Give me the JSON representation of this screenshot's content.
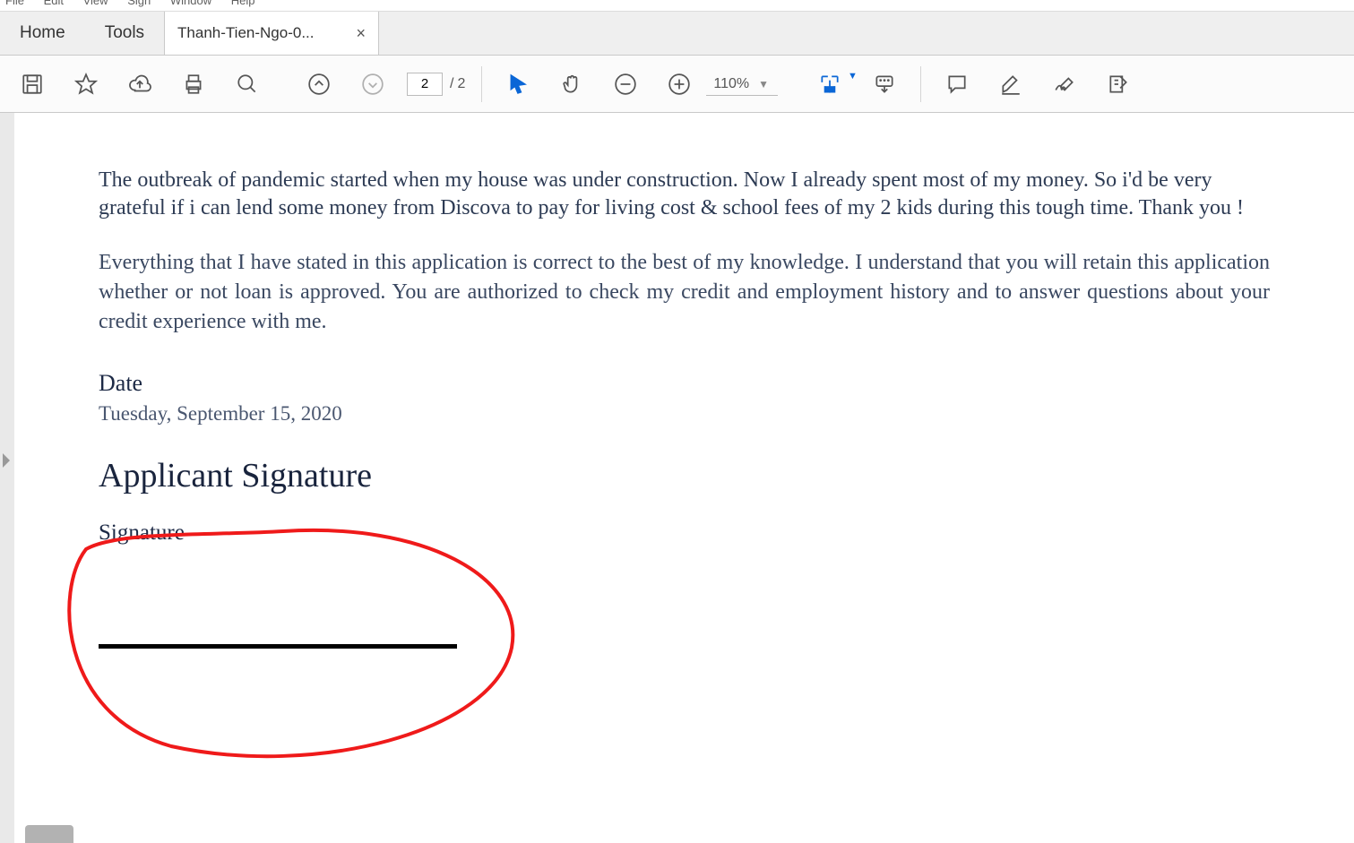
{
  "menubar": {
    "items": [
      "File",
      "Edit",
      "View",
      "Sign",
      "Window",
      "Help"
    ]
  },
  "tabs": {
    "home": "Home",
    "tools": "Tools",
    "doc": "Thanh-Tien-Ngo-0..."
  },
  "toolbar": {
    "page_current": "2",
    "page_sep": "/",
    "page_total": "2",
    "zoom": "110%"
  },
  "document": {
    "para1": "The outbreak of pandemic started when my house was under construction. Now I already spent most of my money. So i'd be very grateful if i can lend some money from Discova to pay for living cost & school fees of my 2 kids during this tough time. Thank you !",
    "para2": "Everything that I have stated in this application is correct to the best of my knowledge. I understand that you will retain this application whether or not loan is approved. You are authorized to check my credit and employment history and to answer questions about your credit experience with me.",
    "date_label": "Date",
    "date_value": "Tuesday, September 15, 2020",
    "signature_heading": "Applicant Signature",
    "signature_label": "Signature"
  }
}
